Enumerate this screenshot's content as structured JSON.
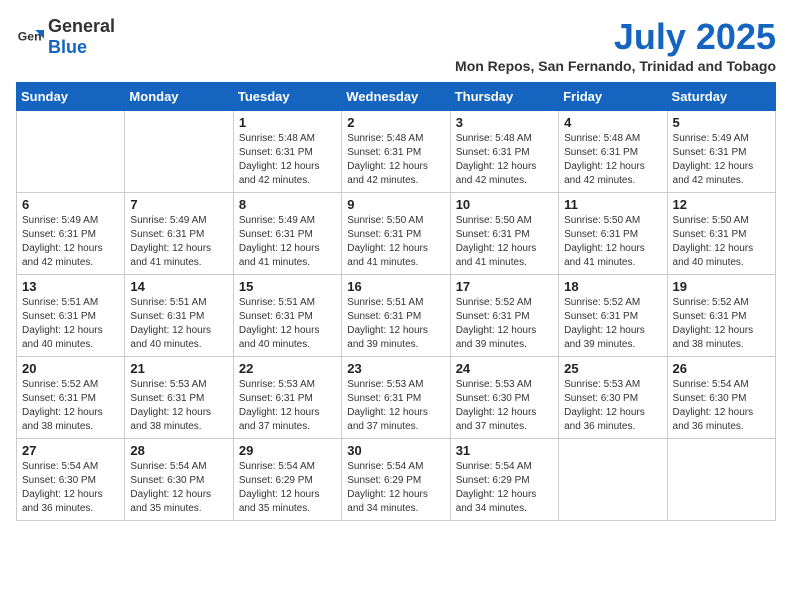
{
  "header": {
    "logo_general": "General",
    "logo_blue": "Blue",
    "title": "July 2025",
    "subtitle": "Mon Repos, San Fernando, Trinidad and Tobago"
  },
  "weekdays": [
    "Sunday",
    "Monday",
    "Tuesday",
    "Wednesday",
    "Thursday",
    "Friday",
    "Saturday"
  ],
  "weeks": [
    [
      {
        "day": "",
        "info": ""
      },
      {
        "day": "",
        "info": ""
      },
      {
        "day": "1",
        "info": "Sunrise: 5:48 AM\nSunset: 6:31 PM\nDaylight: 12 hours and 42 minutes."
      },
      {
        "day": "2",
        "info": "Sunrise: 5:48 AM\nSunset: 6:31 PM\nDaylight: 12 hours and 42 minutes."
      },
      {
        "day": "3",
        "info": "Sunrise: 5:48 AM\nSunset: 6:31 PM\nDaylight: 12 hours and 42 minutes."
      },
      {
        "day": "4",
        "info": "Sunrise: 5:48 AM\nSunset: 6:31 PM\nDaylight: 12 hours and 42 minutes."
      },
      {
        "day": "5",
        "info": "Sunrise: 5:49 AM\nSunset: 6:31 PM\nDaylight: 12 hours and 42 minutes."
      }
    ],
    [
      {
        "day": "6",
        "info": "Sunrise: 5:49 AM\nSunset: 6:31 PM\nDaylight: 12 hours and 42 minutes."
      },
      {
        "day": "7",
        "info": "Sunrise: 5:49 AM\nSunset: 6:31 PM\nDaylight: 12 hours and 41 minutes."
      },
      {
        "day": "8",
        "info": "Sunrise: 5:49 AM\nSunset: 6:31 PM\nDaylight: 12 hours and 41 minutes."
      },
      {
        "day": "9",
        "info": "Sunrise: 5:50 AM\nSunset: 6:31 PM\nDaylight: 12 hours and 41 minutes."
      },
      {
        "day": "10",
        "info": "Sunrise: 5:50 AM\nSunset: 6:31 PM\nDaylight: 12 hours and 41 minutes."
      },
      {
        "day": "11",
        "info": "Sunrise: 5:50 AM\nSunset: 6:31 PM\nDaylight: 12 hours and 41 minutes."
      },
      {
        "day": "12",
        "info": "Sunrise: 5:50 AM\nSunset: 6:31 PM\nDaylight: 12 hours and 40 minutes."
      }
    ],
    [
      {
        "day": "13",
        "info": "Sunrise: 5:51 AM\nSunset: 6:31 PM\nDaylight: 12 hours and 40 minutes."
      },
      {
        "day": "14",
        "info": "Sunrise: 5:51 AM\nSunset: 6:31 PM\nDaylight: 12 hours and 40 minutes."
      },
      {
        "day": "15",
        "info": "Sunrise: 5:51 AM\nSunset: 6:31 PM\nDaylight: 12 hours and 40 minutes."
      },
      {
        "day": "16",
        "info": "Sunrise: 5:51 AM\nSunset: 6:31 PM\nDaylight: 12 hours and 39 minutes."
      },
      {
        "day": "17",
        "info": "Sunrise: 5:52 AM\nSunset: 6:31 PM\nDaylight: 12 hours and 39 minutes."
      },
      {
        "day": "18",
        "info": "Sunrise: 5:52 AM\nSunset: 6:31 PM\nDaylight: 12 hours and 39 minutes."
      },
      {
        "day": "19",
        "info": "Sunrise: 5:52 AM\nSunset: 6:31 PM\nDaylight: 12 hours and 38 minutes."
      }
    ],
    [
      {
        "day": "20",
        "info": "Sunrise: 5:52 AM\nSunset: 6:31 PM\nDaylight: 12 hours and 38 minutes."
      },
      {
        "day": "21",
        "info": "Sunrise: 5:53 AM\nSunset: 6:31 PM\nDaylight: 12 hours and 38 minutes."
      },
      {
        "day": "22",
        "info": "Sunrise: 5:53 AM\nSunset: 6:31 PM\nDaylight: 12 hours and 37 minutes."
      },
      {
        "day": "23",
        "info": "Sunrise: 5:53 AM\nSunset: 6:31 PM\nDaylight: 12 hours and 37 minutes."
      },
      {
        "day": "24",
        "info": "Sunrise: 5:53 AM\nSunset: 6:30 PM\nDaylight: 12 hours and 37 minutes."
      },
      {
        "day": "25",
        "info": "Sunrise: 5:53 AM\nSunset: 6:30 PM\nDaylight: 12 hours and 36 minutes."
      },
      {
        "day": "26",
        "info": "Sunrise: 5:54 AM\nSunset: 6:30 PM\nDaylight: 12 hours and 36 minutes."
      }
    ],
    [
      {
        "day": "27",
        "info": "Sunrise: 5:54 AM\nSunset: 6:30 PM\nDaylight: 12 hours and 36 minutes."
      },
      {
        "day": "28",
        "info": "Sunrise: 5:54 AM\nSunset: 6:30 PM\nDaylight: 12 hours and 35 minutes."
      },
      {
        "day": "29",
        "info": "Sunrise: 5:54 AM\nSunset: 6:29 PM\nDaylight: 12 hours and 35 minutes."
      },
      {
        "day": "30",
        "info": "Sunrise: 5:54 AM\nSunset: 6:29 PM\nDaylight: 12 hours and 34 minutes."
      },
      {
        "day": "31",
        "info": "Sunrise: 5:54 AM\nSunset: 6:29 PM\nDaylight: 12 hours and 34 minutes."
      },
      {
        "day": "",
        "info": ""
      },
      {
        "day": "",
        "info": ""
      }
    ]
  ]
}
